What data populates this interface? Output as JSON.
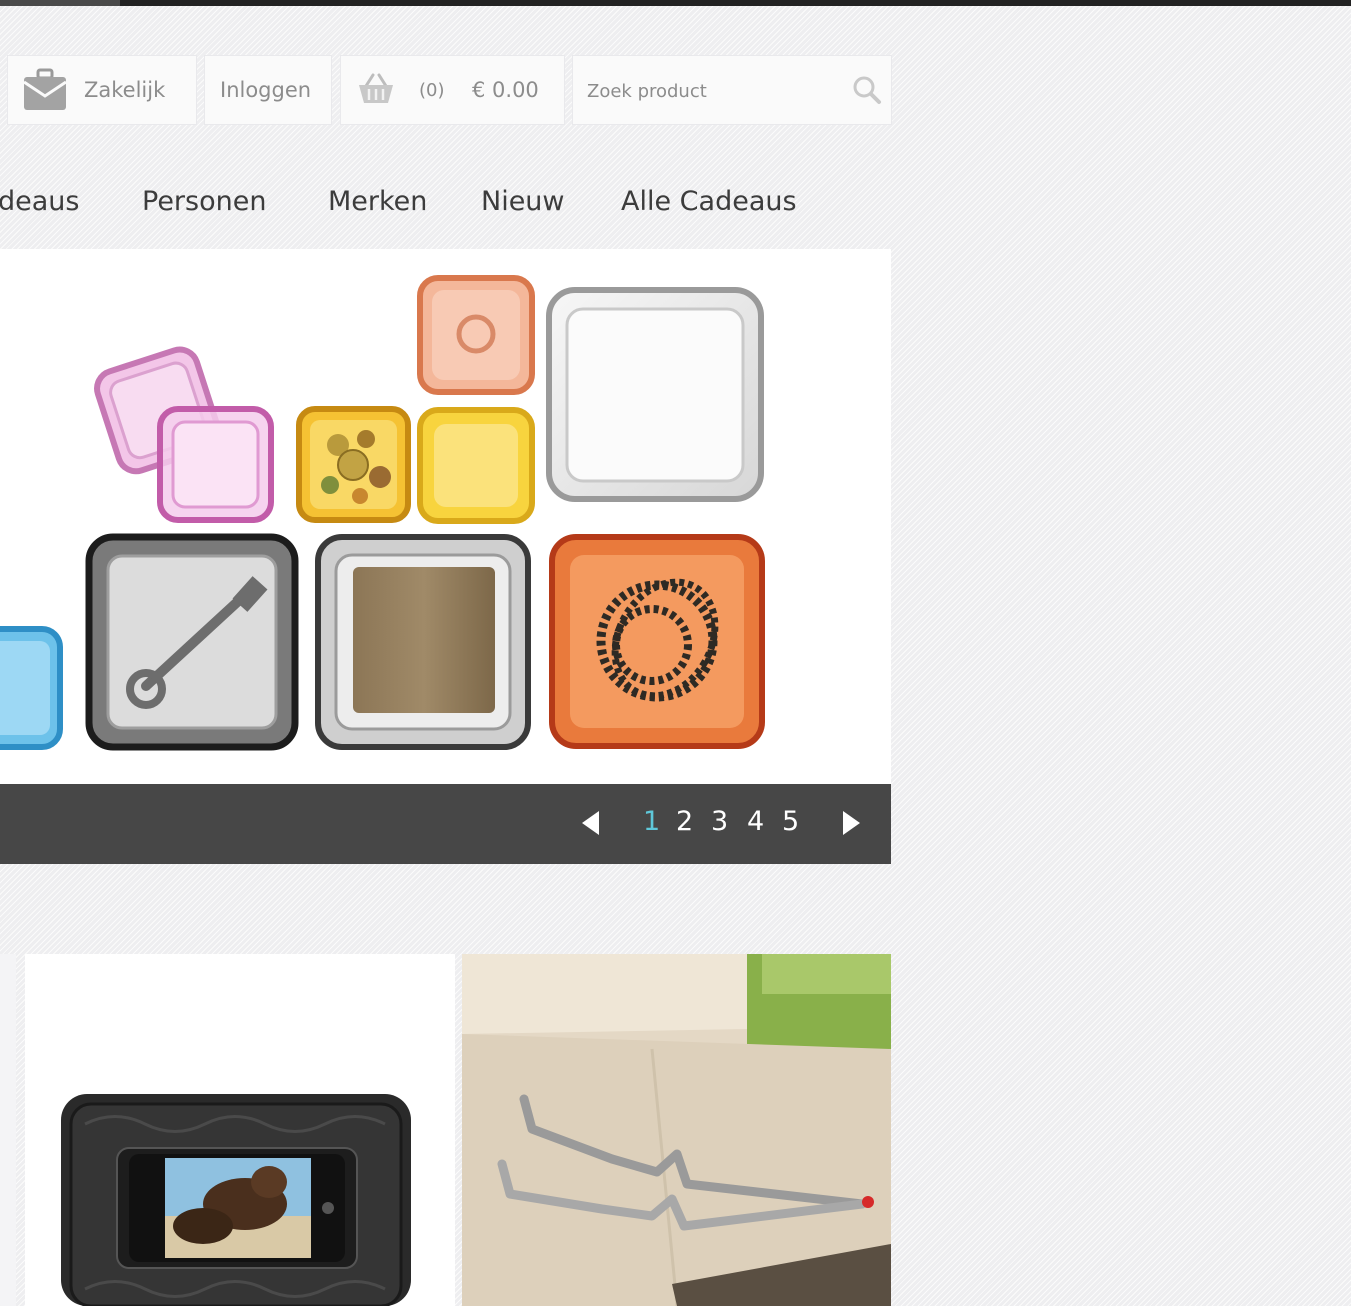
{
  "header": {
    "zakelijk_label": "Zakelijk",
    "inloggen_label": "Inloggen",
    "cart": {
      "count": "(0)",
      "total": "€ 0.00"
    },
    "search": {
      "placeholder": "Zoek product"
    }
  },
  "nav": {
    "items": [
      {
        "label": "deaus"
      },
      {
        "label": "Personen"
      },
      {
        "label": "Merken"
      },
      {
        "label": "Nieuw"
      },
      {
        "label": "Alle Cadeaus"
      }
    ]
  },
  "slider": {
    "pages": [
      "1",
      "2",
      "3",
      "4",
      "5"
    ],
    "active_page": "1"
  },
  "colors": {
    "accent": "#5fc8da",
    "slider_bar": "#474747",
    "nav_text": "#3c3c3c",
    "util_text": "#8c8c8c"
  },
  "icons": [
    "briefcase-icon",
    "basket-icon",
    "search-icon",
    "arrow-left-icon",
    "arrow-right-icon"
  ]
}
